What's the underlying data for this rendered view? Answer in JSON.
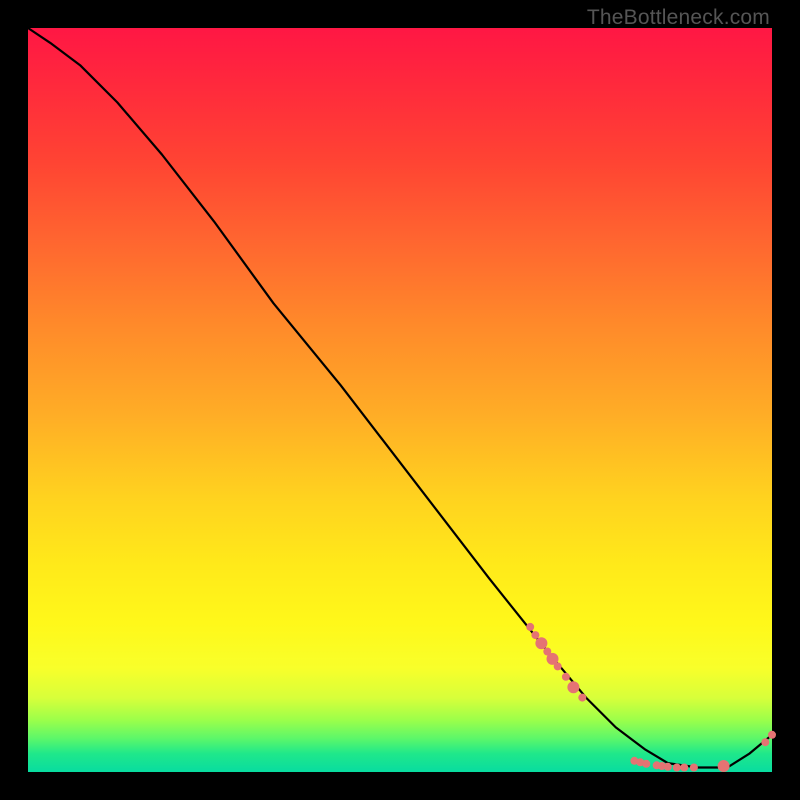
{
  "watermark": "TheBottleneck.com",
  "chart_data": {
    "type": "line",
    "title": "",
    "xlabel": "",
    "ylabel": "",
    "xlim": [
      0,
      100
    ],
    "ylim": [
      0,
      100
    ],
    "grid": false,
    "series": [
      {
        "name": "bottleneck-curve",
        "color": "#000000",
        "x": [
          0,
          3,
          7,
          12,
          18,
          25,
          33,
          42,
          52,
          62,
          70,
          75,
          79,
          83,
          86,
          90,
          94,
          97,
          100
        ],
        "y": [
          100,
          98,
          95,
          90,
          83,
          74,
          63,
          52,
          39,
          26,
          16,
          10,
          6,
          3,
          1.2,
          0.6,
          0.6,
          2.5,
          5
        ]
      }
    ],
    "markers": {
      "name": "highlighted-points",
      "color": "#e57373",
      "radius_small": 4,
      "radius_large": 6,
      "points": [
        {
          "x": 67.5,
          "y": 19.5,
          "r": "small"
        },
        {
          "x": 68.2,
          "y": 18.4,
          "r": "small"
        },
        {
          "x": 69.0,
          "y": 17.3,
          "r": "large"
        },
        {
          "x": 69.8,
          "y": 16.2,
          "r": "small"
        },
        {
          "x": 70.5,
          "y": 15.2,
          "r": "large"
        },
        {
          "x": 71.2,
          "y": 14.2,
          "r": "small"
        },
        {
          "x": 72.3,
          "y": 12.8,
          "r": "small"
        },
        {
          "x": 73.3,
          "y": 11.4,
          "r": "large"
        },
        {
          "x": 74.5,
          "y": 10.0,
          "r": "small"
        },
        {
          "x": 81.5,
          "y": 1.5,
          "r": "small"
        },
        {
          "x": 82.3,
          "y": 1.3,
          "r": "small"
        },
        {
          "x": 83.1,
          "y": 1.1,
          "r": "small"
        },
        {
          "x": 84.5,
          "y": 0.9,
          "r": "small"
        },
        {
          "x": 85.2,
          "y": 0.8,
          "r": "small"
        },
        {
          "x": 86.0,
          "y": 0.7,
          "r": "small"
        },
        {
          "x": 87.2,
          "y": 0.6,
          "r": "small"
        },
        {
          "x": 88.2,
          "y": 0.6,
          "r": "small"
        },
        {
          "x": 89.5,
          "y": 0.6,
          "r": "small"
        },
        {
          "x": 93.5,
          "y": 0.8,
          "r": "large"
        },
        {
          "x": 99.1,
          "y": 4.0,
          "r": "small"
        },
        {
          "x": 100.0,
          "y": 5.0,
          "r": "small"
        }
      ]
    }
  }
}
